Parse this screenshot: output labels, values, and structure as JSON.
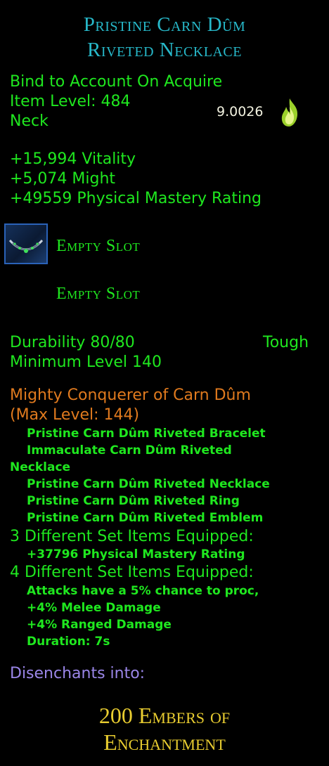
{
  "item": {
    "title_line1": "Pristine Carn Dûm",
    "title_line2": "Riveted Necklace",
    "bind": "Bind to Account On Acquire",
    "item_level": "Item Level: 484",
    "slot": "Neck",
    "value_score": "9.0026",
    "stats": [
      "+15,994 Vitality",
      "+5,074 Might",
      "+49559 Physical Mastery Rating"
    ],
    "essence_slots": [
      "Empty Slot",
      "Empty Slot"
    ],
    "durability": "Durability 80/80",
    "durability_type": "Tough",
    "min_level": "Minimum Level 140"
  },
  "set": {
    "name": "Mighty Conquerer of Carn Dûm",
    "max_level": "(Max Level: 144)",
    "items": [
      "Pristine Carn Dûm Riveted Bracelet",
      "Immaculate Carn Dûm Riveted",
      "Necklace",
      "Pristine Carn Dûm Riveted Necklace",
      "Pristine Carn Dûm Riveted Ring",
      "Pristine Carn Dûm Riveted Emblem"
    ],
    "bonus3_header": "3 Different Set Items Equipped:",
    "bonus3_lines": [
      "+37796 Physical Mastery Rating"
    ],
    "bonus4_header": "4 Different Set Items Equipped:",
    "bonus4_lines": [
      "Attacks have a 5% chance to proc,",
      "+4% Melee Damage",
      "+4% Ranged Damage",
      "Duration: 7s"
    ]
  },
  "disenchant": {
    "label": "Disenchants into:",
    "result_line1": "200 Embers of",
    "result_line2": "Enchantment"
  },
  "colors": {
    "title": "#27b8c9",
    "stat_green": "#1fe81f",
    "set_orange": "#e07a1e",
    "disenchant_purple": "#9a86e8",
    "footer_gold": "#e8cc30"
  },
  "icons": {
    "value": "flame-icon",
    "essence_slot": "necklace-slot-icon"
  }
}
